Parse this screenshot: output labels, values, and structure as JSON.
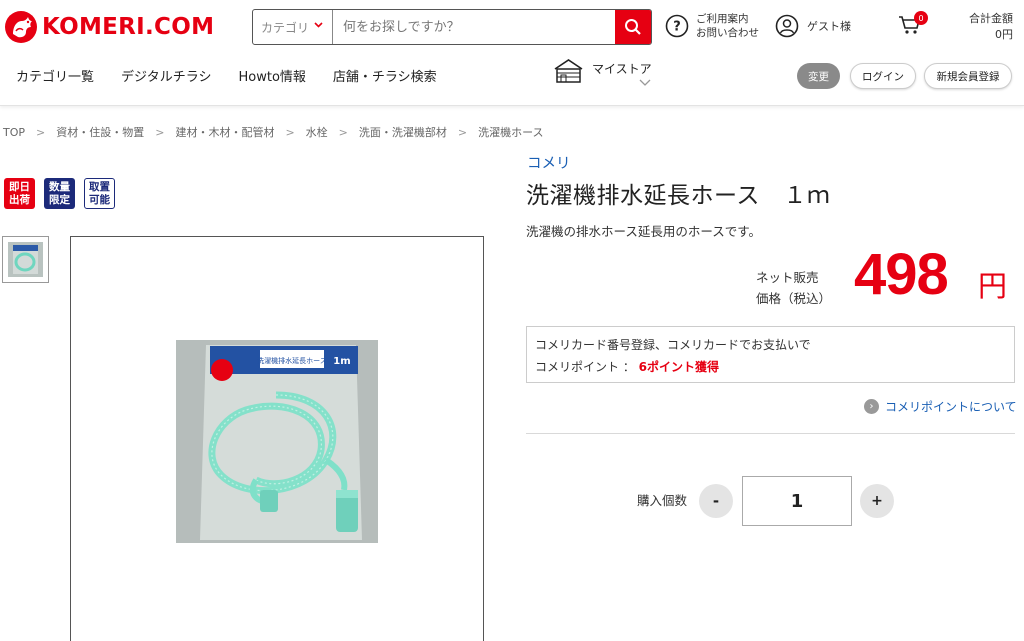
{
  "header": {
    "logo_text": "KOMERI.COM",
    "search": {
      "category_label": "カテゴリ",
      "placeholder": "何をお探しですか？"
    },
    "help": {
      "line1": "ご利用案内",
      "line2": "お問い合わせ"
    },
    "guest_label": "ゲスト様",
    "cart_count": "0",
    "total": {
      "label": "合計金額",
      "value": "0円"
    }
  },
  "nav": {
    "items": [
      {
        "label": "カテゴリ一覧"
      },
      {
        "label": "デジタルチラシ"
      },
      {
        "label": "Howto情報"
      },
      {
        "label": "店舗・チラシ検索"
      }
    ],
    "mystore_label": "マイストア",
    "change_label": "変更",
    "login_label": "ログイン",
    "register_label": "新規会員登録"
  },
  "breadcrumb": [
    "TOP",
    "資材・住設・物置",
    "建材・木材・配管材",
    "水栓",
    "洗面・洗濯機部材",
    "洗濯機ホース"
  ],
  "tags": [
    {
      "line1": "即日",
      "line2": "出荷",
      "style": "red"
    },
    {
      "line1": "数量",
      "line2": "限定",
      "style": "navy"
    },
    {
      "line1": "取置",
      "line2": "可能",
      "style": "outline"
    }
  ],
  "product": {
    "brand": "コメリ",
    "title": "洗濯機排水延長ホース　１ｍ",
    "description": "洗濯機の排水ホース延長用のホースです。",
    "price_label_1": "ネット販売",
    "price_label_2": "価格（税込）",
    "price": "498",
    "price_unit": "円",
    "package_label": "洗濯機排水延長ホース",
    "package_size": "1m",
    "points": {
      "line1": "コメリカード番号登録、コメリカードでお支払いで",
      "line2_prefix": "コメリポイント ： ",
      "line2_value": "6ポイント獲得"
    },
    "points_link": "コメリポイントについて",
    "quantity_label": "購入個数",
    "quantity": "1",
    "minus_label": "-",
    "plus_label": "+"
  },
  "colors": {
    "brand_red": "#e60012",
    "link_blue": "#1a5fb4",
    "navy": "#1c2a7a"
  },
  "icons": {
    "logo": "rooster-logo-icon",
    "search": "search-icon",
    "help": "question-circle-icon",
    "user": "user-icon",
    "cart": "cart-icon",
    "store": "store-icon",
    "chevron": "chevron-down-icon",
    "link_arrow": "chevron-right-circle-icon"
  }
}
